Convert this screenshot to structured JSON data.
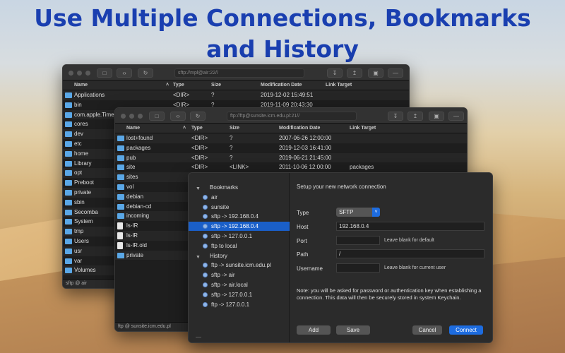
{
  "headline": {
    "line1": "Use Multiple Connections,  Bookmarks",
    "line2": "and History"
  },
  "window1": {
    "address": "sftp://mpl@air:22//",
    "columns": {
      "name": "Name",
      "type": "Type",
      "size": "Size",
      "date": "Modification Date",
      "link": "Link Target"
    },
    "rows": [
      {
        "name": "Applications",
        "type": "<DIR>",
        "size": "?",
        "date": "2019-12-02 15:49:51",
        "kind": "folder"
      },
      {
        "name": "bin",
        "type": "<DIR>",
        "size": "?",
        "date": "2019-11-09 20:43:30",
        "kind": "folder"
      },
      {
        "name": "com.apple.Timel",
        "type": "",
        "size": "",
        "date": "",
        "kind": "folder"
      },
      {
        "name": "cores",
        "kind": "folder"
      },
      {
        "name": "dev",
        "kind": "folder"
      },
      {
        "name": "etc",
        "kind": "folder"
      },
      {
        "name": "home",
        "kind": "folder"
      },
      {
        "name": "Library",
        "kind": "folder"
      },
      {
        "name": "opt",
        "kind": "folder"
      },
      {
        "name": "Preboot",
        "kind": "folder"
      },
      {
        "name": "private",
        "kind": "folder"
      },
      {
        "name": "sbin",
        "kind": "folder"
      },
      {
        "name": "Secomba",
        "kind": "folder"
      },
      {
        "name": "System",
        "kind": "folder"
      },
      {
        "name": "tmp",
        "kind": "folder"
      },
      {
        "name": "Users",
        "kind": "folder"
      },
      {
        "name": "usr",
        "kind": "folder"
      },
      {
        "name": "var",
        "kind": "folder"
      },
      {
        "name": "Volumes",
        "kind": "folder"
      }
    ],
    "status": "sftp @ air"
  },
  "window2": {
    "address": "ftp://ftp@sunsite.icm.edu.pl:21//",
    "columns": {
      "name": "Name",
      "type": "Type",
      "size": "Size",
      "date": "Modification Date",
      "link": "Link Target"
    },
    "rows": [
      {
        "name": "lost+found",
        "type": "<DIR>",
        "size": "?",
        "date": "2007-06-26 12:00:00",
        "link": "",
        "kind": "folder"
      },
      {
        "name": "packages",
        "type": "<DIR>",
        "size": "?",
        "date": "2019-12-03 16:41:00",
        "link": "",
        "kind": "folder"
      },
      {
        "name": "pub",
        "type": "<DIR>",
        "size": "?",
        "date": "2019-06-21 21:45:00",
        "link": "",
        "kind": "folder"
      },
      {
        "name": "site",
        "type": "<DIR>",
        "size": "<LINK>",
        "date": "2011-10-06 12:00:00",
        "link": "packages",
        "kind": "link"
      },
      {
        "name": "sites",
        "kind": "folder"
      },
      {
        "name": "vol",
        "kind": "folder"
      },
      {
        "name": "debian",
        "kind": "folder"
      },
      {
        "name": "debian-cd",
        "kind": "folder"
      },
      {
        "name": "incoming",
        "kind": "folder"
      },
      {
        "name": "ls-IR",
        "kind": "file"
      },
      {
        "name": "ls-lR",
        "kind": "file"
      },
      {
        "name": "ls-lR.old",
        "kind": "file"
      },
      {
        "name": "private",
        "kind": "folder"
      }
    ],
    "status": "ftp @ sunsite.icm.edu.pl"
  },
  "dialog": {
    "sidebar": {
      "bookmarks_label": "Bookmarks",
      "bookmarks": [
        "air",
        "sunsite",
        "sftp -> 192.168.0.4",
        "sftp -> 192.168.0.4",
        "sftp -> 127.0.0.1",
        "ftp to local"
      ],
      "history_label": "History",
      "history": [
        "ftp -> sunsite.icm.edu.pl",
        "sftp -> air",
        "sftp -> air.local",
        "sftp -> 127.0.0.1",
        "ftp -> 127.0.0.1"
      ]
    },
    "heading": "Setup your new network connection",
    "type_label": "Type",
    "type_value": "SFTP",
    "host_label": "Host",
    "host_value": "192.168.0.4",
    "port_label": "Port",
    "port_value": "",
    "port_hint": "Leave blank for default",
    "path_label": "Path",
    "path_value": "/",
    "username_label": "Username",
    "username_value": "",
    "username_hint": "Leave blank for current user",
    "note": "Note: you will be asked for password or authentication key when establishing a connection. This data will then be securely stored in system Keychain.",
    "add_label": "Add",
    "save_label": "Save",
    "cancel_label": "Cancel",
    "connect_label": "Connect"
  },
  "colors": {
    "headline": "#1a3fb0",
    "accent": "#1d6ce0",
    "folder": "#5aa7e6"
  }
}
